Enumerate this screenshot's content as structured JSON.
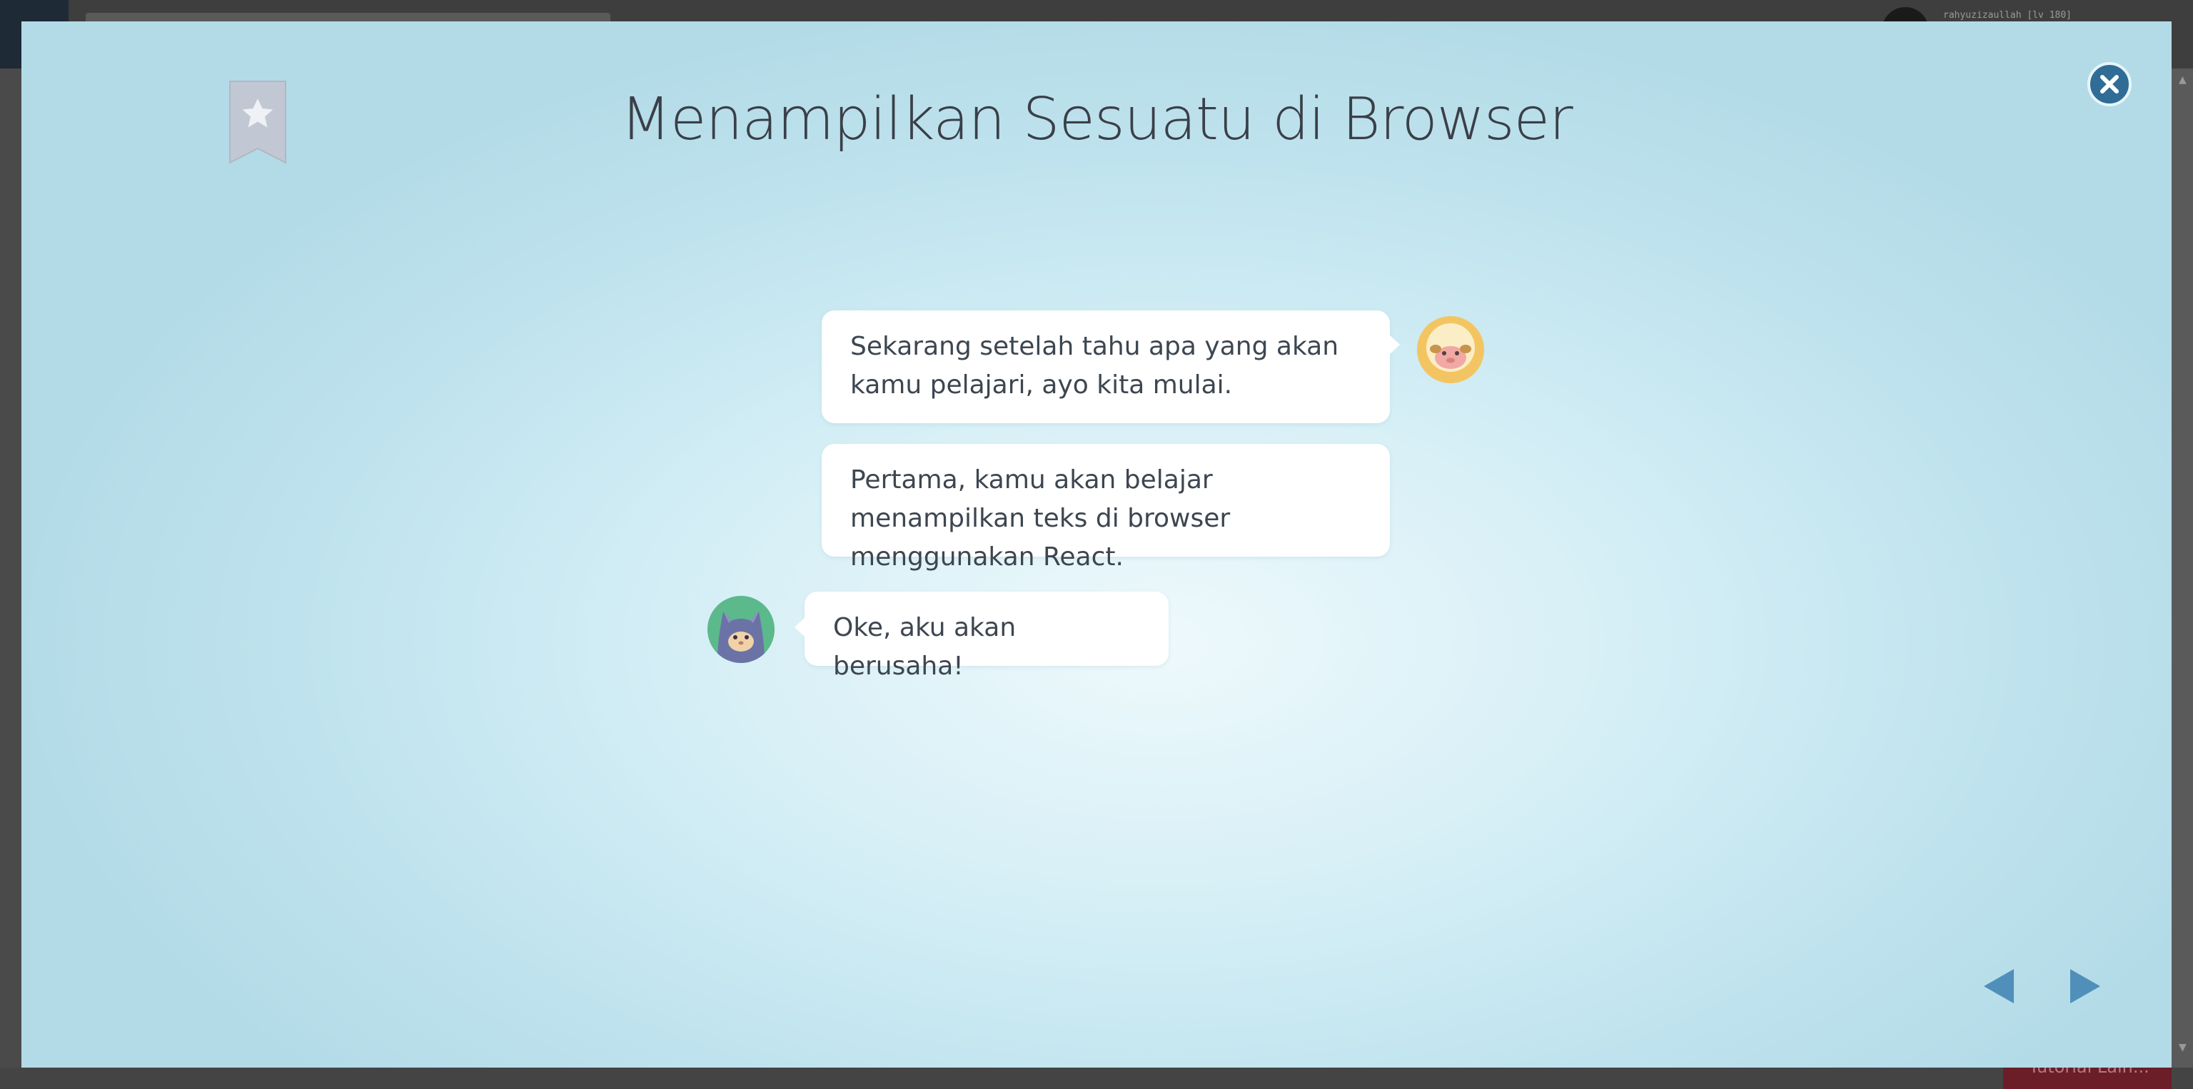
{
  "background": {
    "username": "rahyuzizaullah [lv 180]",
    "bottom_button_label": "Tutorial Lain..."
  },
  "modal": {
    "title": "Menampilkan Sesuatu di Browser",
    "messages": [
      {
        "speaker": "sheep",
        "side": "right",
        "text": "Sekarang setelah tahu apa yang akan kamu pelajari, ayo kita mulai."
      },
      {
        "speaker": "sheep",
        "side": "right",
        "text": "Pertama, kamu akan belajar menampilkan teks di browser menggunakan React."
      },
      {
        "speaker": "cat",
        "side": "left",
        "text": "Oke, aku akan berusaha!"
      }
    ],
    "icons": {
      "bookmark": "bookmark-star-icon",
      "close": "close-icon",
      "prev": "previous-arrow-icon",
      "next": "next-arrow-icon"
    },
    "colors": {
      "close_button": "#2f6c96",
      "nav_arrow": "#4f8fba",
      "bookmark": "#c2c8d3"
    }
  }
}
